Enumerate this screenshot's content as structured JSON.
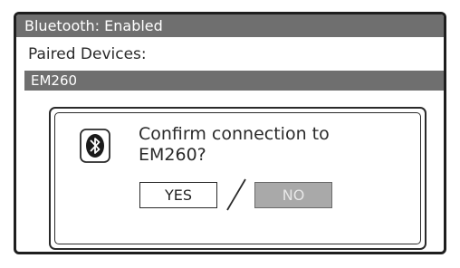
{
  "header": {
    "title": "Bluetooth: Enabled"
  },
  "devices": {
    "label": "Paired Devices:",
    "items": [
      {
        "name": "EM260",
        "selected": true
      }
    ]
  },
  "dialog": {
    "icon": "bluetooth-icon",
    "message_line1": "Confirm connection to",
    "message_line2": "EM260?",
    "yes_label": "YES",
    "no_label": "NO",
    "separator_icon": "slash-separator"
  },
  "colors": {
    "bar": "#6f6f6f",
    "border": "#1e1e1e",
    "disabled_button": "#a9a9a9",
    "text": "#2a2a2a"
  }
}
